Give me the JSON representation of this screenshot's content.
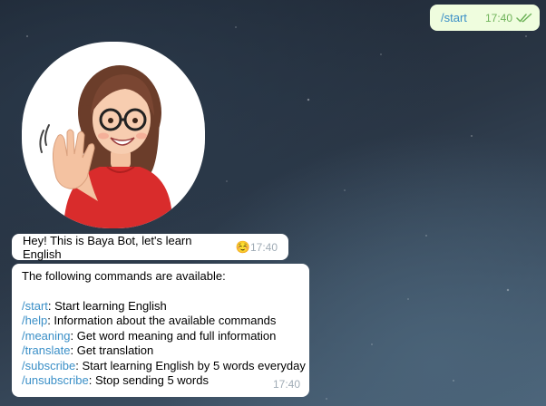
{
  "colors": {
    "outgoing_bubble": "#effdde",
    "incoming_bubble": "#ffffff",
    "link": "#3a8fc7",
    "read_ticks": "#6fb35a",
    "timestamp_in": "#a0acb6"
  },
  "outgoing": {
    "text": "/start",
    "time": "17:40",
    "status_icon": "double-check-icon"
  },
  "sticker": {
    "icon": "waving-girl-sticker"
  },
  "greeting": {
    "text": "Hey! This is Baya Bot, let's learn English",
    "emoji": "☺️",
    "time": "17:40"
  },
  "commands": {
    "intro": "The following commands are available:",
    "time": "17:40",
    "items": [
      {
        "cmd": "/start",
        "desc": ": Start learning English"
      },
      {
        "cmd": "/help",
        "desc": ": Information about the available commands"
      },
      {
        "cmd": "/meaning",
        "desc": ": Get word meaning and full information"
      },
      {
        "cmd": "/translate",
        "desc": ": Get translation"
      },
      {
        "cmd": "/subscribe",
        "desc": ": Start learning English by 5 words everyday"
      },
      {
        "cmd": "/unsubscribe",
        "desc": ": Stop sending 5 words"
      }
    ]
  }
}
